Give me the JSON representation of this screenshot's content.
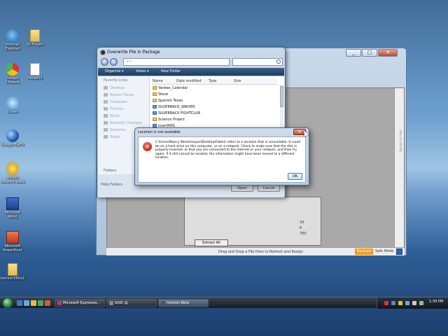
{
  "desktop": {
    "icons": [
      {
        "label": "Internet Explorer"
      },
      {
        "label": "SS Project"
      },
      {
        "label": "Google Chrome"
      },
      {
        "label": "Here802"
      },
      {
        "label": "iTunes"
      },
      {
        "label": "Google Earth"
      },
      {
        "label": "Norton Security Suite"
      },
      {
        "label": "Microsoft Word"
      },
      {
        "label": "Microsoft PowerPoint"
      },
      {
        "label": "horizon360v2"
      }
    ]
  },
  "overwrite_dialog": {
    "title": "Overwrite File in Package",
    "address": "« ›",
    "toolbar": {
      "organize": "Organize ▾",
      "views": "Views ▾",
      "new_folder": "New Folder"
    },
    "favorite_links_title": "Favorite Links",
    "favorites": [
      "Desktop",
      "Recent Places",
      "Computer",
      "Pictures",
      "Music",
      "Recently Changed",
      "Searches",
      "Public"
    ],
    "folders_label": "Folders",
    "columns": [
      "Name",
      "Date modified",
      "Type",
      "Size"
    ],
    "files": [
      "Yankee_Calendar",
      "Steve",
      "Spanish Texas",
      "SILVERBACK_WAIVER",
      "SILVERBACK FIGHTCLUB",
      "Science Project",
      "scan0001"
    ],
    "hide_folders": "Hide Folders",
    "open_button": "Open",
    "cancel_button": "Cancel"
  },
  "error_dialog": {
    "title": "Location is not available",
    "message": "C:\\Users\\Nancy Montemayor\\Desktop\\Fable3 refers to a location that is unavailable. It could be on a hard drive on this computer, or on a network. Check to make sure that the disk is properly inserted, or that you are connected to the Internet or your network, and then try again. If it still cannot be located, the information might have been moved to a different location.",
    "ok_button": "OK",
    "close_glyph": "✕"
  },
  "horizon_window": {
    "status_text": "Drag and Drop a File Here to Refresh and Resign",
    "backups_button": "Backups",
    "safe_mode_label": "Safe Mode",
    "dock_label": "Docked by Poet",
    "extract_all": "Extract All",
    "numbers": [
      "43",
      "6",
      "760"
    ],
    "title_buttons": [
      "_",
      "□",
      "✕"
    ]
  },
  "taskbar": {
    "tasks": [
      "Microsoft Expressio...",
      "SAID @",
      "Horizon Beta"
    ],
    "clock": "1:39 PM"
  },
  "colors": {
    "backups_orange": "#f59a1b",
    "error_red": "#b0160b",
    "toolbar_dark": "#1f3d60"
  }
}
